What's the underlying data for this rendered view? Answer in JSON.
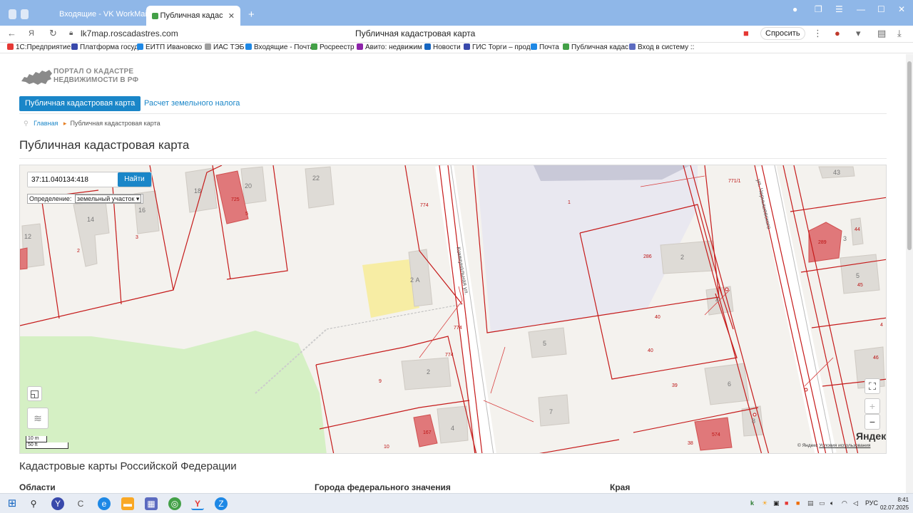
{
  "browser": {
    "tabs": [
      {
        "label": "Входящие - VK WorkMail"
      },
      {
        "label": "Публичная кадастровая карта"
      }
    ],
    "url": "lk7map.roscadastres.com",
    "page_title": "Публичная кадастровая карта",
    "ask_label": "Спросить"
  },
  "bookmarks": [
    {
      "label": "1С:Предприятие",
      "color": "#e53935"
    },
    {
      "label": "Платформа госуд",
      "color": "#3949ab"
    },
    {
      "label": "ЕИТП Ивановско",
      "color": "#1e88e5"
    },
    {
      "label": "ИАС ТЭБ",
      "color": "#9e9e9e"
    },
    {
      "label": "Входящие - Почта",
      "color": "#1e88e5"
    },
    {
      "label": "Росреестр",
      "color": "#43a047"
    },
    {
      "label": "Авито: недвижим",
      "color": "#8e24aa"
    },
    {
      "label": "Новости",
      "color": "#1565c0"
    },
    {
      "label": "ГИС Торги – прод",
      "color": "#3949ab"
    },
    {
      "label": "Почта",
      "color": "#1e88e5"
    },
    {
      "label": "Публичная кадас",
      "color": "#43a047"
    },
    {
      "label": "Вход в систему ::",
      "color": "#5c6bc0"
    }
  ],
  "site": {
    "logo_line1": "ПОРТАЛ О КАДАСТРЕ",
    "logo_line2": "НЕДВИЖИМОСТИ В РФ",
    "menu_active": "Публичная кадастровая карта",
    "menu_second": "Расчет земельного налога",
    "breadcrumb_home": "Главная",
    "breadcrumb_current": "Публичная кадастровая карта",
    "heading": "Публичная кадастровая карта"
  },
  "map": {
    "search_value": "37:11.040134:418",
    "search_button": "Найти",
    "definition_label": "Определение:",
    "definition_value": "земельный участок",
    "scale_m": "10 m",
    "scale_ft": "50 ft",
    "copyright": "© Яндекс",
    "terms": "Условия использования",
    "brand": "Яндекс",
    "street_1": "Коммунальная ул.",
    "street_2": "ул. Чернышевского",
    "labels": {
      "b18": "18",
      "b20": "20",
      "b22": "22",
      "b16": "16",
      "b14": "14",
      "b12": "12",
      "n2": "2",
      "n3": "3",
      "n5": "5",
      "p725": "725",
      "n774a": "774",
      "n1": "1",
      "n771": "771/1",
      "b43": "43",
      "b44": "44",
      "p289": "289",
      "b3": "3",
      "b5r": "5",
      "n45": "45",
      "n286": "286",
      "b2r": "2",
      "b2a": "2 А",
      "n774b": "774",
      "n774c": "774",
      "b4r": "4",
      "n40a": "40",
      "n40b": "40",
      "b5m": "5",
      "b2m": "2",
      "n9": "9",
      "n39": "39",
      "b6": "6",
      "n4": "4",
      "n46": "46",
      "b7": "7",
      "p167": "167",
      "b4m": "4",
      "n10": "10",
      "p574": "574",
      "b8": "8",
      "n38": "38"
    }
  },
  "sections": {
    "heading": "Кадастровые карты Российской Федерации",
    "col1": "Области",
    "col2": "Города федерального значения",
    "col3": "Края"
  },
  "taskbar": {
    "lang": "РУС",
    "time": "8:41",
    "date": "02.07.2025"
  }
}
